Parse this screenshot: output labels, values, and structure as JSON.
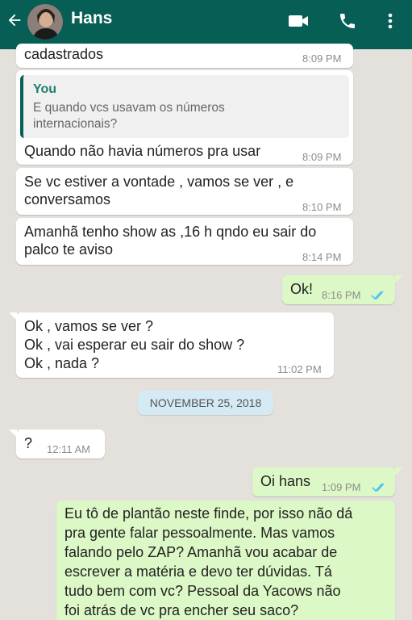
{
  "header": {
    "contact_name": "Hans",
    "bg_color": "#075e54"
  },
  "icons": {
    "back": "arrow-left-icon",
    "video": "video-camera-icon",
    "call": "phone-icon",
    "more": "more-vertical-icon"
  },
  "messages": [
    {
      "direction": "in",
      "lines": [
        "cadastrados"
      ],
      "time": "8:09 PM"
    },
    {
      "direction": "in",
      "reply_to": {
        "author": "You",
        "lines": [
          "E quando vcs usavam os números",
          "internacionais?"
        ]
      },
      "lines": [
        "Quando não havia números pra usar"
      ],
      "time": "8:09 PM"
    },
    {
      "direction": "in",
      "lines": [
        "Se vc estiver a vontade , vamos se ver , e",
        "conversamos"
      ],
      "time": "8:10 PM"
    },
    {
      "direction": "in",
      "lines": [
        "Amanhã tenho show as ,16 h qndo eu sair do",
        "palco te aviso"
      ],
      "time": "8:14 PM"
    },
    {
      "direction": "out",
      "lines": [
        "Ok!"
      ],
      "time": "8:16 PM",
      "status": "read"
    },
    {
      "direction": "in",
      "lines": [
        "Ok , vamos se ver ?",
        "Ok , vai esperar eu sair do show ?",
        "Ok , nada ?"
      ],
      "time": "11:02 PM"
    },
    {
      "direction": "in",
      "lines": [
        "?"
      ],
      "time": "12:11 AM"
    },
    {
      "direction": "out",
      "lines": [
        "Oi hans"
      ],
      "time": "1:09 PM",
      "status": "read"
    },
    {
      "direction": "out",
      "lines": [
        "Eu tô de plantão neste finde, por isso não dá",
        "pra gente falar pessoalmente. Mas vamos",
        "falando pelo ZAP? Amanhã vou acabar de",
        "escrever a matéria e devo ter dúvidas. Tá",
        "tudo bem com vc? Pessoal da Yacows não",
        "foi atrás de vc pra encher seu saco?"
      ]
    }
  ],
  "date_divider": "NOVEMBER 25, 2018",
  "colors": {
    "incoming": "#ffffff",
    "outgoing": "#dcf8c6",
    "read_ticks": "#4fc3f7",
    "chat_bg": "#e4e0db"
  }
}
